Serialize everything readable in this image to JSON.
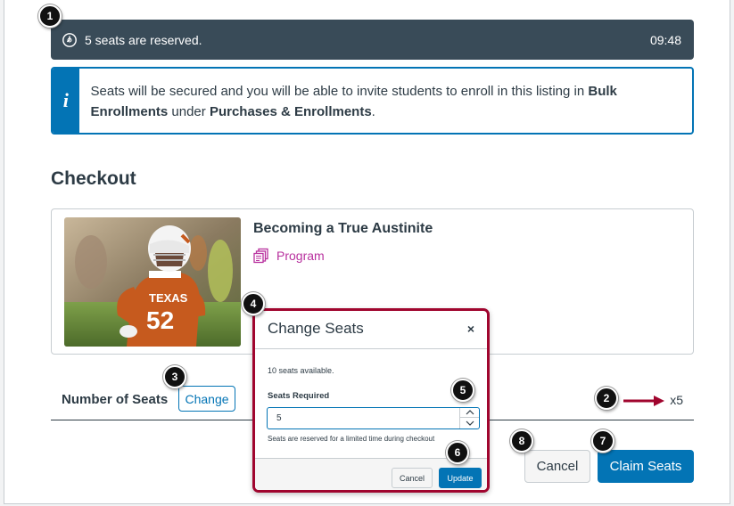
{
  "timer": {
    "message": "5 seats are reserved.",
    "time": "09:48"
  },
  "info": {
    "icon": "i",
    "text_pre": "Seats will be secured and you will be able to invite students to enroll in this listing in ",
    "bold1": "Bulk Enrollments",
    "text_mid": " under ",
    "bold2": "Purchases & Enrollments",
    "text_post": "."
  },
  "checkout": {
    "title": "Checkout",
    "product": {
      "name": "Becoming a True Austinite",
      "type": "Program"
    }
  },
  "seats": {
    "label": "Number of Seats",
    "change_label": "Change",
    "count": "x5"
  },
  "modal": {
    "title": "Change Seats",
    "close": "×",
    "available": "10 seats available.",
    "required_label": "Seats Required",
    "required_value": "5",
    "hint": "Seats are reserved for a limited time during checkout",
    "cancel_label": "Cancel",
    "update_label": "Update"
  },
  "actions": {
    "cancel_label": "Cancel",
    "claim_label": "Claim Seats"
  },
  "callouts": [
    "1",
    "2",
    "3",
    "4",
    "5",
    "6",
    "7",
    "8"
  ],
  "colors": {
    "accent": "#0374b5",
    "program": "#b8309e",
    "modal_border": "#a0052e",
    "timer_bg": "#394b58"
  }
}
